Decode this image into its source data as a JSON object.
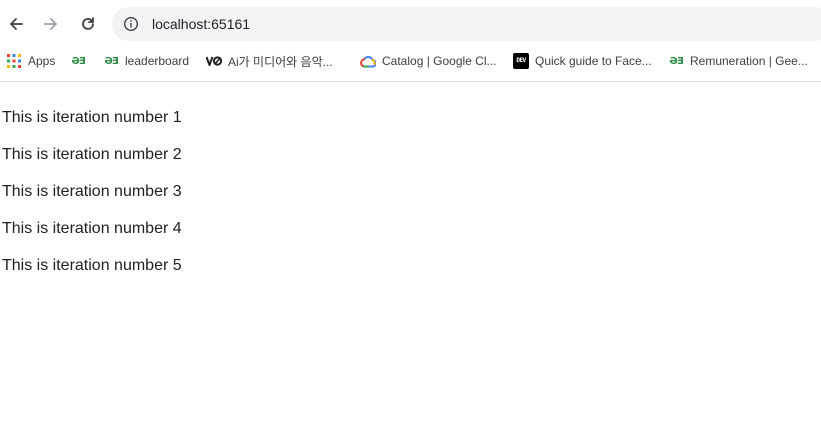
{
  "browser": {
    "url": "localhost:65161",
    "back_icon": "arrow-left-icon",
    "forward_icon": "arrow-right-icon",
    "reload_icon": "reload-icon",
    "site_info_icon": "info-icon"
  },
  "bookmarks": {
    "items": [
      {
        "label": "Apps",
        "icon": "apps-grid-icon"
      },
      {
        "label": "",
        "icon": "gfg-icon"
      },
      {
        "label": "leaderboard",
        "icon": "gfg-icon"
      },
      {
        "label": "Ai가 미디어와 음악...",
        "icon": "vo-icon"
      },
      {
        "label": "Catalog | Google Cl...",
        "icon": "google-cloud-icon"
      },
      {
        "label": "Quick guide to Face...",
        "icon": "dev-icon"
      },
      {
        "label": "Remuneration | Gee...",
        "icon": "gfg-icon"
      }
    ],
    "gfg_glyph": "ƏƎ",
    "dev_glyph": "DEV"
  },
  "content": {
    "lines": [
      "This is iteration number 1",
      "This is iteration number 2",
      "This is iteration number 3",
      "This is iteration number 4",
      "This is iteration number 5"
    ]
  },
  "colors": {
    "gfg_green": "#2f8d46",
    "omnibox_bg": "#f1f3f4",
    "text": "#202124"
  }
}
